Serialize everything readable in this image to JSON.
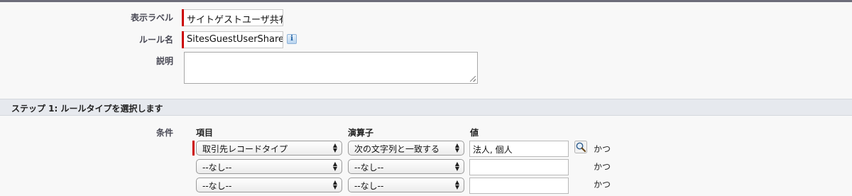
{
  "form": {
    "display_label": {
      "label": "表示ラベル",
      "value": "サイトゲストユーザ共有"
    },
    "rule_name": {
      "label": "ルール名",
      "value": "SitesGuestUserShare"
    },
    "description": {
      "label": "説明",
      "value": ""
    }
  },
  "step1": {
    "title": "ステップ 1: ルールタイプを選択します",
    "criteria_label": "条件",
    "columns": {
      "field": "項目",
      "operator": "演算子",
      "value": "値"
    },
    "rows": [
      {
        "field": "取引先レコードタイプ",
        "operator": "次の文字列と一致する",
        "value": "法人, 個人",
        "conj": "かつ"
      },
      {
        "field": "--なし--",
        "operator": "--なし--",
        "value": "",
        "conj": "かつ"
      },
      {
        "field": "--なし--",
        "operator": "--なし--",
        "value": "",
        "conj": "かつ"
      }
    ]
  },
  "icons": {
    "info": "info-icon",
    "lookup": "lookup-search-icon"
  },
  "colors": {
    "required_bar": "#cc0000",
    "section_bar": "#e6e9ee"
  }
}
